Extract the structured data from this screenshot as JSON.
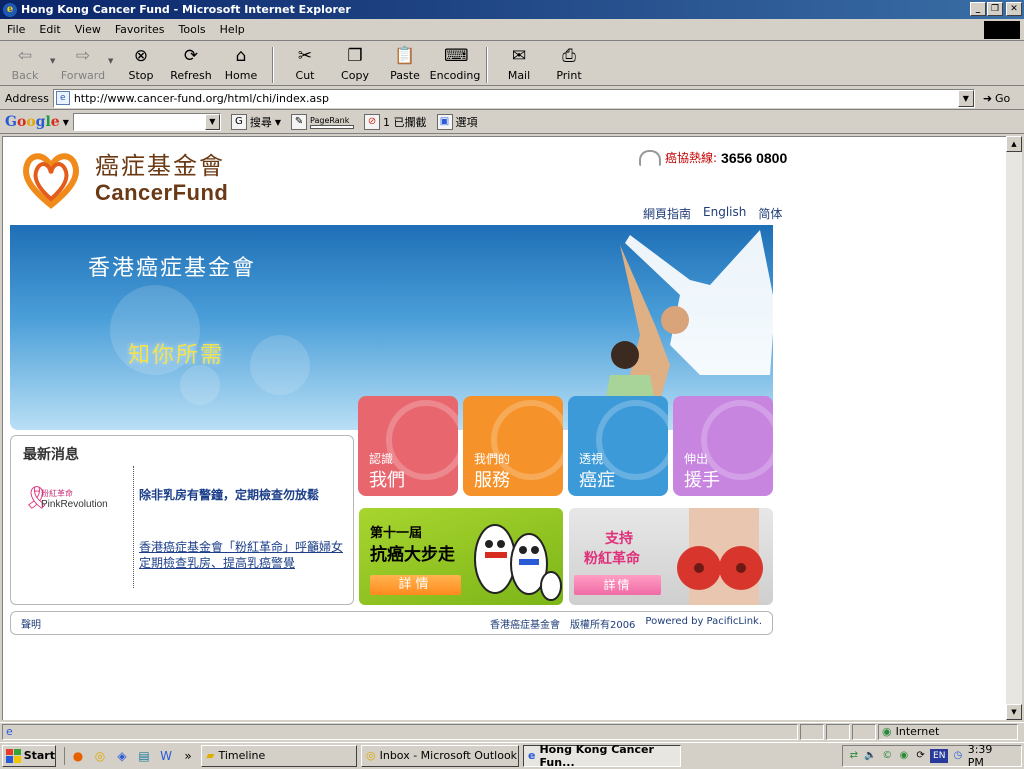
{
  "window": {
    "title": "Hong Kong Cancer Fund - Microsoft Internet Explorer"
  },
  "menu": [
    "File",
    "Edit",
    "View",
    "Favorites",
    "Tools",
    "Help"
  ],
  "toolbar": {
    "back": "Back",
    "forward": "Forward",
    "stop": "Stop",
    "refresh": "Refresh",
    "home": "Home",
    "cut": "Cut",
    "copy": "Copy",
    "paste": "Paste",
    "encoding": "Encoding",
    "mail": "Mail",
    "print": "Print"
  },
  "address": {
    "label": "Address",
    "url": "http://www.cancer-fund.org/html/chi/index.asp",
    "go": "Go"
  },
  "googlebar": {
    "logo": "Google",
    "search_label": "搜尋",
    "pagerank": "PageRank",
    "blocked": "1 已攔截",
    "options": "選項"
  },
  "page": {
    "logo_cn": "癌症基金會",
    "logo_en": "CancerFund",
    "hotline_label": "癌協熱線:",
    "hotline_number": "3656 0800",
    "lang_links": [
      "網頁指南",
      "English",
      "简体"
    ],
    "banner_title": "香港癌症基金會",
    "banner_slogan": "知你所需",
    "tiles": [
      {
        "small": "認識",
        "large": "我們",
        "color": "#e8676f"
      },
      {
        "small": "我們的",
        "large": "服務",
        "color": "#f5922a"
      },
      {
        "small": "透視",
        "large": "癌症",
        "color": "#3d9ad9"
      },
      {
        "small": "伸出",
        "large": "援手",
        "color": "#c785e0"
      }
    ],
    "news": {
      "header": "最新消息",
      "pink_cn": "粉紅革命",
      "pink_en": "PinkRevolution",
      "headline": "除非乳房有警鐘，定期檢查勿放鬆",
      "link": "香港癌症基金會「粉紅革命」呼籲婦女定期檢查乳房、提高乳癌警覺"
    },
    "walk": {
      "line1": "第十一屆",
      "line2": "抗癌大步走",
      "button": "詳情"
    },
    "pink": {
      "line1": "支持",
      "line2": "粉紅革命",
      "button": "詳情"
    },
    "footer": {
      "left": "聲明",
      "org": "香港癌症基金會",
      "copyright": "版權所有2006",
      "powered": "Powered by PacificLink."
    }
  },
  "status": {
    "zone": "Internet"
  },
  "taskbar": {
    "start": "Start",
    "tasks": [
      "Timeline",
      "Inbox - Microsoft Outlook",
      "Hong Kong Cancer Fun..."
    ],
    "lang": "EN",
    "clock": "3:39 PM"
  }
}
